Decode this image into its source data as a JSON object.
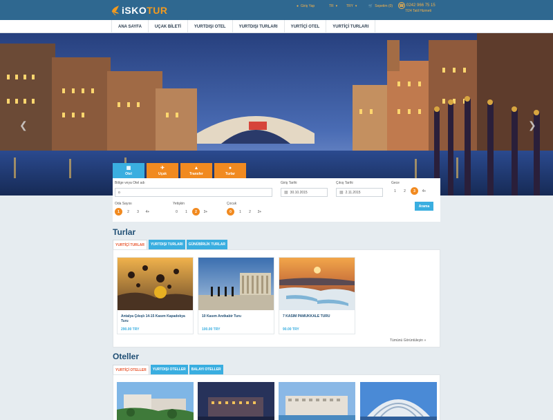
{
  "brand": {
    "logo_part1": "iSKO",
    "logo_part2": "TUR"
  },
  "topbar": {
    "login": "Giriş Yap",
    "language": "TR",
    "currency": "TRY",
    "basket": "Sepetim (0)",
    "phone": "0242 966 75 15",
    "service": "7/24 Tatil Hizmeti"
  },
  "nav": {
    "items": [
      "ANA SAYFA",
      "UÇAK BİLETİ",
      "YURTDIŞI OTEL",
      "YURTDIŞI TURLARI",
      "YURTİÇİ OTEL",
      "YURTİÇİ TURLARI"
    ]
  },
  "booking": {
    "tabs": [
      {
        "label": "Otel",
        "icon": "building-icon"
      },
      {
        "label": "Uçak",
        "icon": "plane-icon"
      },
      {
        "label": "Transfer",
        "icon": "car-icon"
      },
      {
        "label": "Turlar",
        "icon": "tour-icon"
      }
    ],
    "search_label": "Bölge veya Otel adı",
    "search_value": "o",
    "checkin_label": "Giriş Tarihi",
    "checkin_value": "30.10.2015",
    "checkout_label": "Çıkış Tarihi",
    "checkout_value": "2.11.2015",
    "nights_label": "Gece",
    "nights_options": [
      "1",
      "2",
      "3",
      "4+"
    ],
    "nights_selected": "3",
    "rooms_label": "Oda Sayısı",
    "rooms_options": [
      "1",
      "2",
      "3",
      "4+"
    ],
    "rooms_selected": "1",
    "adults_label": "Yetişkin",
    "adults_options": [
      "0",
      "1",
      "2",
      "3+"
    ],
    "adults_selected": "2",
    "children_label": "Çocuk",
    "children_options": [
      "0",
      "1",
      "2",
      "3+"
    ],
    "children_selected": "0",
    "button": "Arama"
  },
  "tours": {
    "title": "Turlar",
    "tabs": [
      "YURTİÇİ TURLAR",
      "YURTDIŞI TURLARI",
      "GÜNÜBİRLİK TURLAR"
    ],
    "items": [
      {
        "name": "Antalya Çıkışlı 14-15 Kasım Kapadokya Turu",
        "price": "290.00 TRY"
      },
      {
        "name": "10 Kasım Anıtkabir Turu",
        "price": "100.00 TRY"
      },
      {
        "name": "7 KASIM PAMUKKALE TURU",
        "price": "90.00 TRY"
      }
    ],
    "more": "Tümünü Görüntüleyin »"
  },
  "hotels": {
    "title": "Oteller",
    "tabs": [
      "YURTİÇİ OTELLER",
      "YURTDIŞI OTELLER",
      "BALAYI OTELLER"
    ]
  }
}
